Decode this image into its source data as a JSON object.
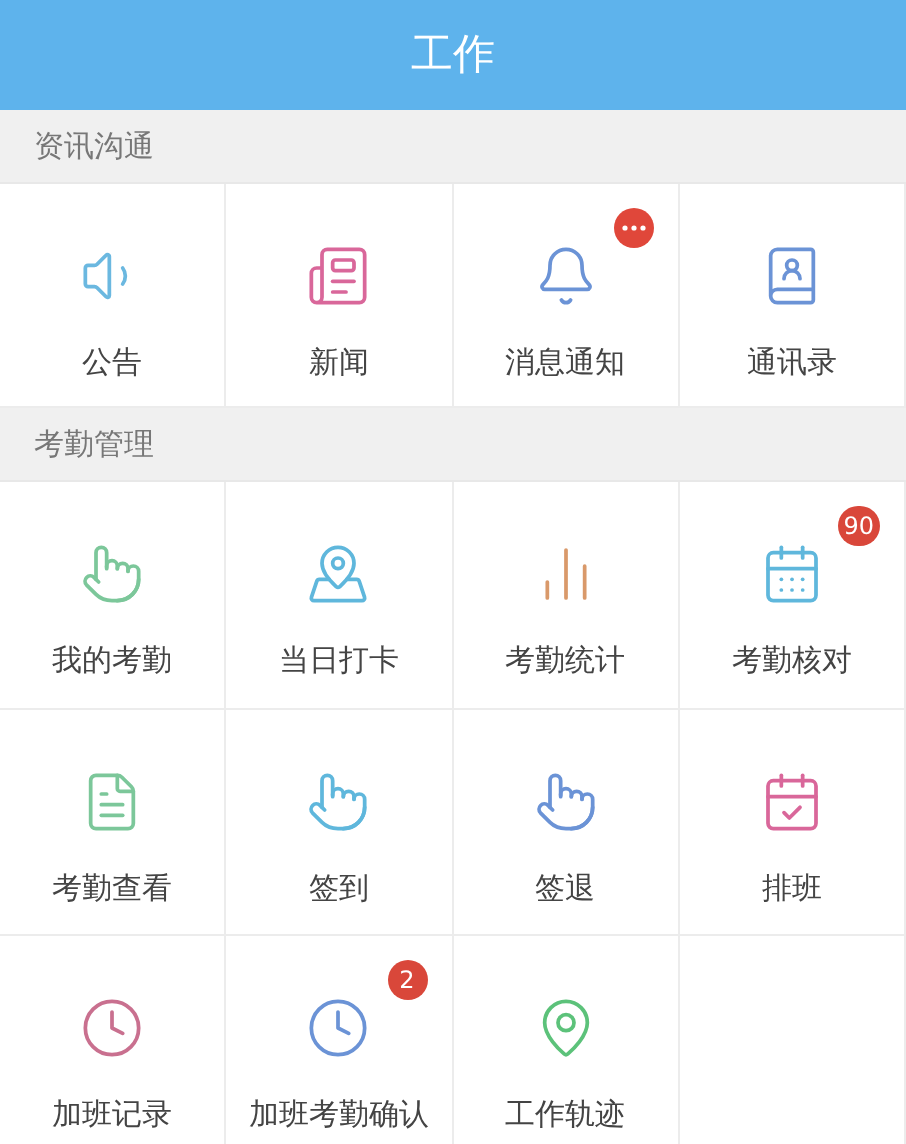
{
  "header": {
    "title": "工作"
  },
  "sections": [
    {
      "title": "资讯沟通",
      "items": [
        {
          "label": "公告",
          "color": "#6bb8e0"
        },
        {
          "label": "新闻",
          "color": "#d9679a"
        },
        {
          "label": "消息通知",
          "color": "#6b93d6",
          "badge": {
            "kind": "dots"
          }
        },
        {
          "label": "通讯录",
          "color": "#6b93d6"
        }
      ]
    },
    {
      "title": "考勤管理",
      "items": [
        {
          "label": "我的考勤",
          "color": "#7cc79a"
        },
        {
          "label": "当日打卡",
          "color": "#5fb7dc"
        },
        {
          "label": "考勤统计",
          "color": "#d9996a"
        },
        {
          "label": "考勤核对",
          "color": "#5fb7dc",
          "badge": {
            "kind": "count",
            "text": "90"
          }
        },
        {
          "label": "考勤查看",
          "color": "#7cc79a"
        },
        {
          "label": "签到",
          "color": "#5fb7dc"
        },
        {
          "label": "签退",
          "color": "#6b93d6"
        },
        {
          "label": "排班",
          "color": "#d9679a"
        },
        {
          "label": "加班记录",
          "color": "#c9708f"
        },
        {
          "label": "加班考勤确认",
          "color": "#6b93d6",
          "badge": {
            "kind": "count",
            "text": "2"
          }
        },
        {
          "label": "工作轨迹",
          "color": "#5cc27a"
        }
      ]
    }
  ]
}
